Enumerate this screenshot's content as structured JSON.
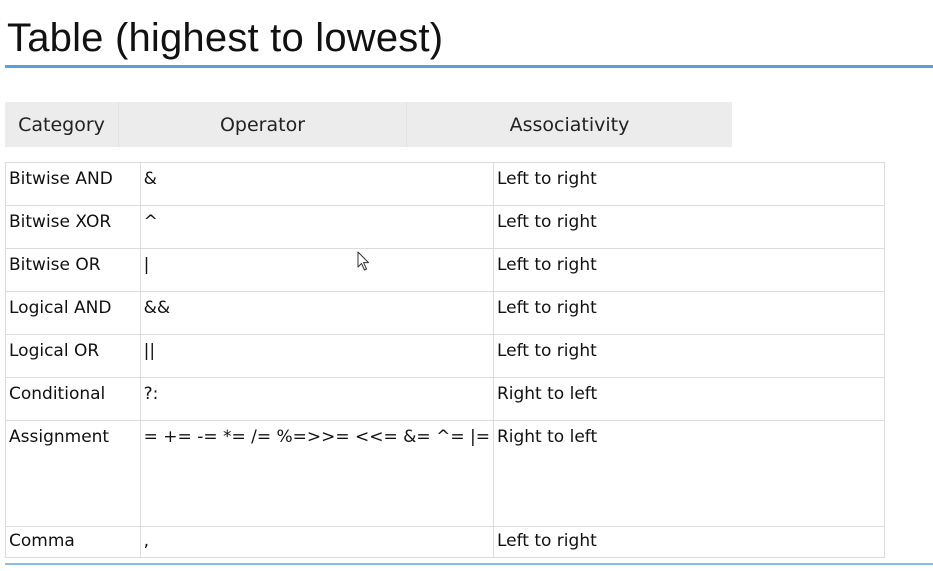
{
  "title": "Table (highest to lowest)",
  "header": {
    "category": "Category",
    "operator": "Operator",
    "associativity": "Associativity"
  },
  "rows": [
    {
      "category": "Bitwise AND",
      "operator": "&",
      "associativity": "Left to right"
    },
    {
      "category": "Bitwise XOR",
      "operator": "^",
      "associativity": "Left to right"
    },
    {
      "category": "Bitwise OR",
      "operator": "|",
      "associativity": "Left to right"
    },
    {
      "category": "Logical AND",
      "operator": "&&",
      "associativity": "Left to right"
    },
    {
      "category": "Logical OR",
      "operator": "||",
      "associativity": "Left to right"
    },
    {
      "category": "Conditional",
      "operator": "?:",
      "associativity": "Right to left"
    },
    {
      "category": "Assignment",
      "operator": "= += -= *= /= %=>>= <<= &= ^= |=",
      "associativity": "Right to left"
    },
    {
      "category": "Comma",
      "operator": ",",
      "associativity": "Left to right"
    }
  ],
  "colors": {
    "rule": "#5aa0dc",
    "header_bg": "#ececec",
    "border": "#dcdcdc"
  },
  "icons": {
    "cursor": "mouse-pointer-icon"
  }
}
